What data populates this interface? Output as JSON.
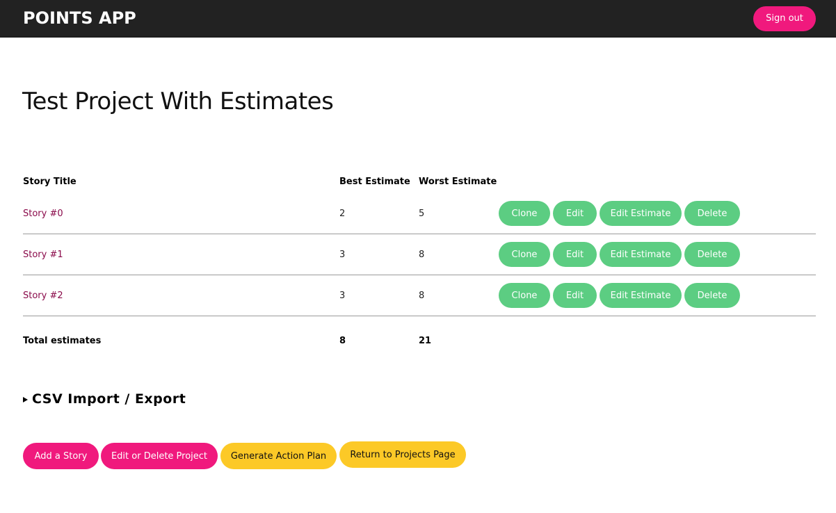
{
  "header": {
    "brand": "POINTS APP",
    "sign_out_label": "Sign out"
  },
  "project": {
    "title": "Test Project With Estimates"
  },
  "table": {
    "columns": {
      "title": "Story Title",
      "best": "Best Estimate",
      "worst": "Worst Estimate"
    },
    "rows": [
      {
        "title": "Story #0",
        "best": "2",
        "worst": "5"
      },
      {
        "title": "Story #1",
        "best": "3",
        "worst": "8"
      },
      {
        "title": "Story #2",
        "best": "3",
        "worst": "8"
      }
    ],
    "actions": {
      "clone": "Clone",
      "edit": "Edit",
      "edit_estimate": "Edit Estimate",
      "delete": "Delete"
    },
    "totals": {
      "label": "Total estimates",
      "best": "8",
      "worst": "21"
    }
  },
  "csv": {
    "label": "CSV Import / Export"
  },
  "footer_buttons": {
    "add_story": "Add a Story",
    "edit_delete_project": "Edit or Delete Project",
    "generate_action_plan": "Generate Action Plan",
    "return_projects": "Return to Projects Page"
  },
  "colors": {
    "topbar": "#222222",
    "pink": "#f0197d",
    "green": "#5ccd82",
    "yellow": "#fcc927",
    "link": "#8a0a4a"
  }
}
